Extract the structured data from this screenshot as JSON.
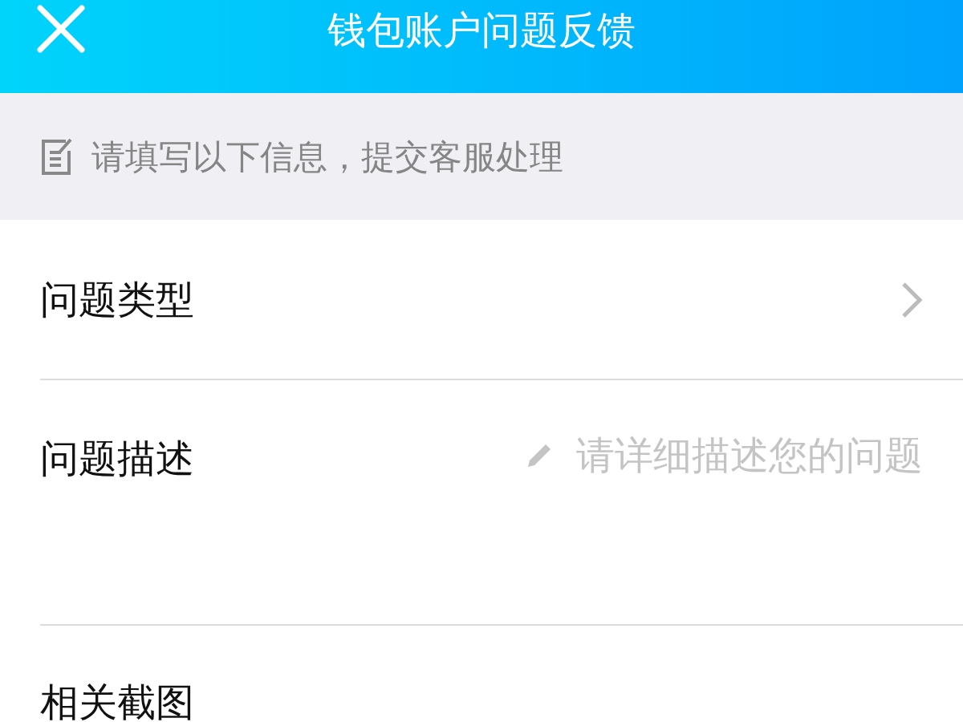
{
  "header": {
    "title": "钱包账户问题反馈"
  },
  "notice": {
    "text": "请填写以下信息，提交客服处理"
  },
  "form": {
    "type_row": {
      "label": "问题类型"
    },
    "description_row": {
      "label": "问题描述",
      "placeholder": "请详细描述您的问题"
    },
    "screenshot_row": {
      "label": "相关截图"
    }
  }
}
